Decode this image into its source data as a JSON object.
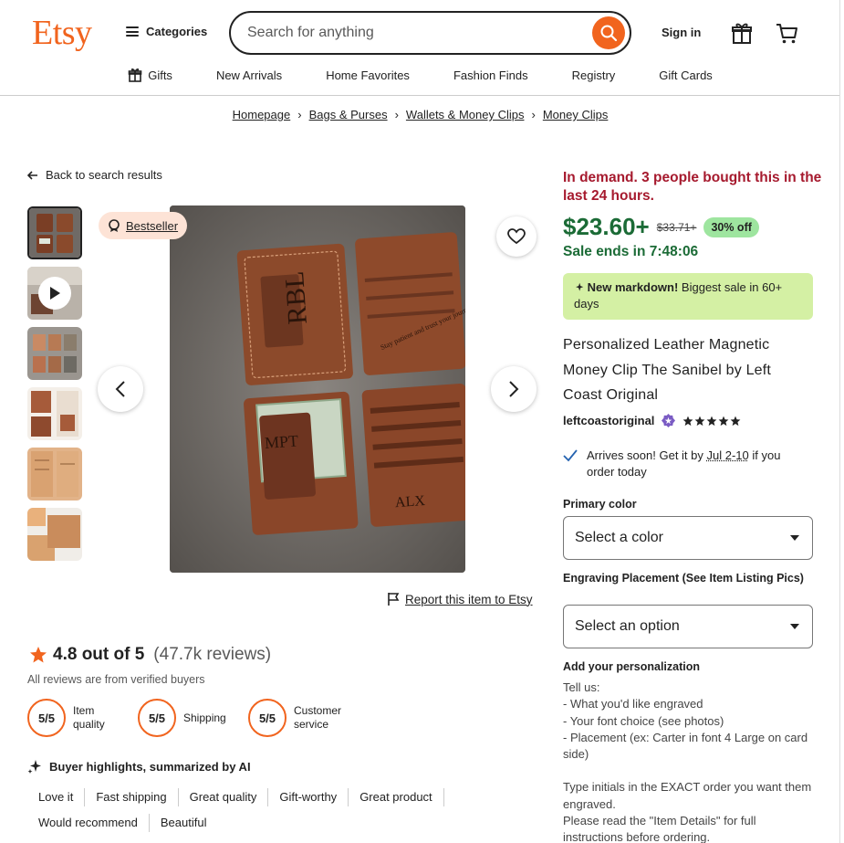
{
  "header": {
    "logo": "Etsy",
    "categories_label": "Categories",
    "search_placeholder": "Search for anything",
    "signin_label": "Sign in"
  },
  "subnav": [
    "Gifts",
    "New Arrivals",
    "Home Favorites",
    "Fashion Finds",
    "Registry",
    "Gift Cards"
  ],
  "breadcrumb": [
    "Homepage",
    "Bags & Purses",
    "Wallets & Money Clips",
    "Money Clips"
  ],
  "back_label": "Back to search results",
  "gallery": {
    "badge": "Bestseller",
    "engraving_top": "RBL",
    "engraving_mid": "MPT",
    "engraving_bottom": "ALX",
    "engraving_quote": "Stay patient and trust your journey."
  },
  "report_label": "Report this item to Etsy",
  "reviews": {
    "rating_text": "4.8 out of 5",
    "count_text": "(47.7k reviews)",
    "verified": "All reviews are from verified buyers",
    "scores": [
      {
        "value": "5/5",
        "label1": "Item",
        "label2": "quality"
      },
      {
        "value": "5/5",
        "label1": "Shipping",
        "label2": ""
      },
      {
        "value": "5/5",
        "label1": "Customer",
        "label2": "service"
      }
    ],
    "ai_title": "Buyer highlights, summarized by AI",
    "tags": [
      "Love it",
      "Fast shipping",
      "Great quality",
      "Gift-worthy",
      "Great product",
      "Would recommend",
      "Beautiful"
    ]
  },
  "product": {
    "demand": "In demand. 3 people bought this in the last 24 hours.",
    "price": "$23.60+",
    "original_price": "$33.71+",
    "discount": "30% off",
    "sale_ends": "Sale ends in 7:48:06",
    "markdown_bold": "New markdown!",
    "markdown_text": " Biggest sale in 60+ days",
    "title": "Personalized Leather Magnetic Money Clip The Sanibel by Left Coast Original",
    "shop": "leftcoastoriginal",
    "star_rating": 5,
    "arrives_pre": "Arrives soon! Get it by ",
    "arrives_date": "Jul 2-10",
    "arrives_post": " if you order today",
    "primary_color_label": "Primary color",
    "primary_color_value": "Select a color",
    "engraving_label": "Engraving Placement (See Item Listing Pics)",
    "engraving_value": "Select an option",
    "personalization_label": "Add your personalization",
    "instructions": [
      "Tell us:",
      "- What you'd like engraved",
      "- Your font choice (see photos)",
      "- Placement (ex: Carter in font 4 Large on card side)",
      "",
      "Type initials in the EXACT order you want them engraved.",
      "Please read the \"Item Details\" for full instructions before ordering."
    ]
  },
  "colors": {
    "brand": "#f1641e",
    "demand": "#a61a2e",
    "price": "#1b6b36",
    "discount_bg": "#9ee59f",
    "markdown_bg": "#d4f0a4"
  }
}
